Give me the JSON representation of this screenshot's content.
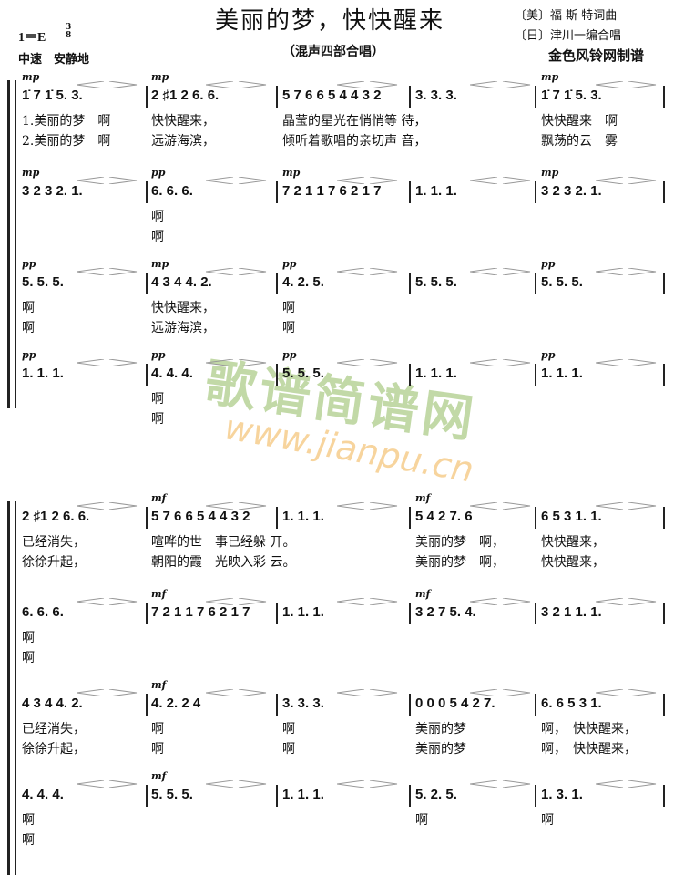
{
  "header": {
    "title": "美丽的梦，快快醒来",
    "subtitle": "（混声四部合唱）",
    "key": "1＝E",
    "time_signature": {
      "top": "3",
      "bottom": "8"
    },
    "tempo": "中速　安静地",
    "credit_lyrics": "〔美〕福 斯 特词曲",
    "credit_arrange": "〔日〕津川一编合唱",
    "maker": "金色风铃网制谱"
  },
  "watermark": {
    "text_cn": "歌谱简谱网",
    "url": "www.jianpu.cn"
  },
  "systems": [
    {
      "parts": [
        {
          "dynamics": [
            "mp",
            "mp",
            "",
            "",
            "mp"
          ],
          "measures": [
            "1̇ 7 1̇ 5.  3.",
            "2 ♯1 2 6.  6.",
            "5 7 6 6 5 4 4 3 2",
            "3.  3.  3.",
            "1̇ 7 1̇ 5.  3."
          ],
          "lyrics": [
            [
              "1.美丽的梦　啊",
              "快快醒来，",
              "晶莹的星光在悄悄等 待，",
              "",
              "快快醒来　啊"
            ],
            [
              "2.美丽的梦　啊",
              "远游海滨，",
              "倾听着歌唱的亲切声 音，",
              "",
              "飘荡的云　雾"
            ]
          ]
        },
        {
          "dynamics": [
            "mp",
            "pp",
            "mp",
            "",
            "mp"
          ],
          "measures": [
            "3 2 3 2.  1.",
            "6.  6.  6.",
            "7 2 1 1 7 6 2 1 7",
            "1.  1.  1.",
            "3 2 3 2.  1."
          ],
          "lyrics": [
            [
              "",
              "啊",
              "",
              "",
              ""
            ],
            [
              "",
              "啊",
              "",
              "",
              ""
            ]
          ]
        },
        {
          "dynamics": [
            "pp",
            "mp",
            "pp",
            "",
            "pp"
          ],
          "measures": [
            "5.  5.  5.",
            "4 3 4 4.  2.",
            "4.  2.  5.",
            "5.  5.  5.",
            "5.  5.  5."
          ],
          "lyrics": [
            [
              "啊",
              "快快醒来，",
              "啊",
              "",
              ""
            ],
            [
              "啊",
              "远游海滨，",
              "啊",
              "",
              ""
            ]
          ]
        },
        {
          "dynamics": [
            "pp",
            "pp",
            "pp",
            "",
            "pp"
          ],
          "measures": [
            "1.  1.  1.",
            "4.  4.  4.",
            "5.  5.  5.",
            "1.  1.  1.",
            "1.  1.  1."
          ],
          "lyrics": [
            [
              "",
              "啊",
              "",
              "",
              ""
            ],
            [
              "",
              "啊",
              "",
              "",
              ""
            ]
          ]
        }
      ]
    },
    {
      "parts": [
        {
          "dynamics": [
            "",
            "mf",
            "",
            "mf",
            ""
          ],
          "measures": [
            "2 ♯1 2 6.  6.",
            "5 7 6 6 5 4 4 3 2",
            "1.  1.  1.",
            "5 4 2 7.  6",
            "6 5 3 1.  1."
          ],
          "lyrics": [
            [
              "已经消失，",
              "喧哗的世　事已经躲 开。",
              "",
              "美丽的梦　啊，",
              "快快醒来，"
            ],
            [
              "徐徐升起，",
              "朝阳的霞　光映入彩 云。",
              "",
              "美丽的梦　啊，",
              "快快醒来，"
            ]
          ]
        },
        {
          "dynamics": [
            "",
            "mf",
            "",
            "mf",
            ""
          ],
          "measures": [
            "6.  6.  6.",
            "7 2 1 1 7 6 2 1 7",
            "1.  1.  1.",
            "3 2 7 5.  4.",
            "3 2 1 1.  1."
          ],
          "lyrics": [
            [
              "啊",
              "",
              "",
              "",
              ""
            ],
            [
              "啊",
              "",
              "",
              "",
              ""
            ]
          ]
        },
        {
          "dynamics": [
            "",
            "mf",
            "",
            "",
            ""
          ],
          "measures": [
            "4 3 4 4.  2.",
            "4.  2. 2  4",
            "3.  3.  3.",
            "0 0 0 5 4 2 7.",
            "6.  6 5 3 1."
          ],
          "lyrics": [
            [
              "已经消失，",
              "啊",
              "啊",
              "美丽的梦",
              "啊，　快快醒来，"
            ],
            [
              "徐徐升起，",
              "啊",
              "啊",
              "美丽的梦",
              "啊，　快快醒来，"
            ]
          ]
        },
        {
          "dynamics": [
            "",
            "mf",
            "",
            "",
            ""
          ],
          "measures": [
            "4.  4.  4.",
            "5.  5.  5.",
            "1.  1.  1.",
            "5.  2.  5.",
            "1.  3.  1."
          ],
          "lyrics": [
            [
              "啊",
              "",
              "",
              "啊",
              "啊"
            ],
            [
              "啊",
              "",
              "",
              "",
              ""
            ]
          ]
        }
      ]
    }
  ]
}
